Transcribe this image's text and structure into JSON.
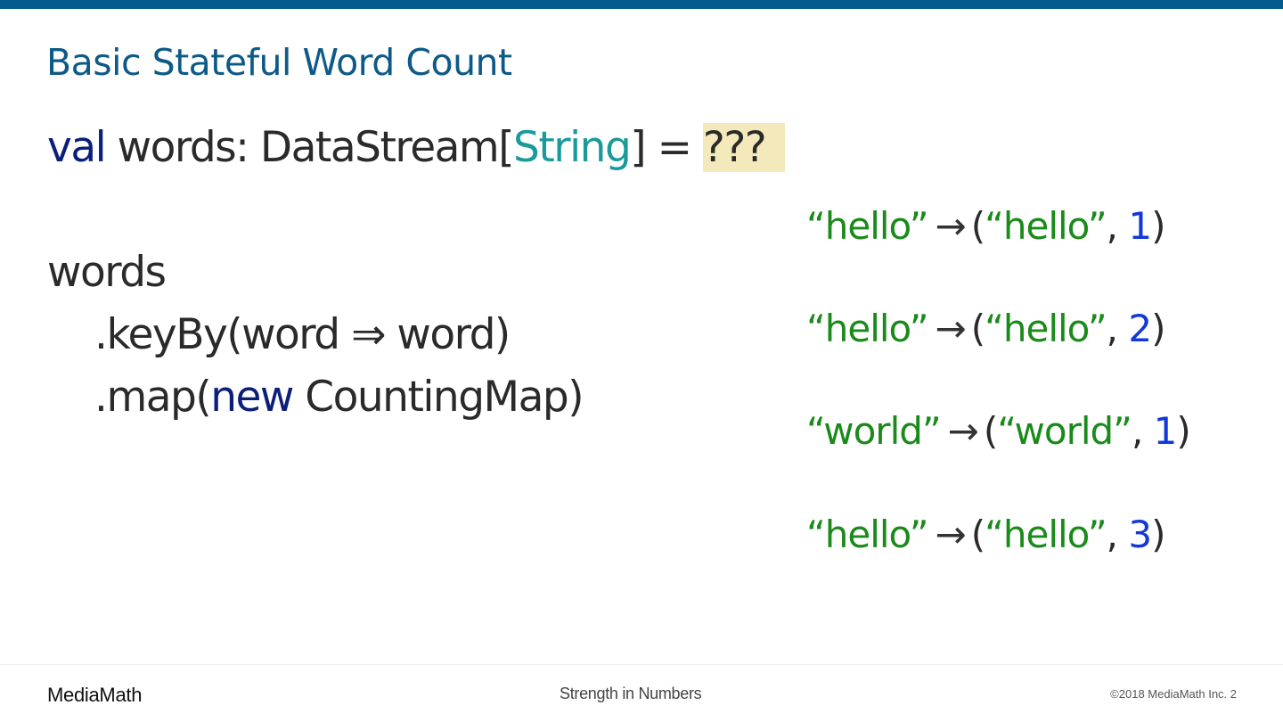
{
  "slide": {
    "title": "Basic Stateful Word Count",
    "code": {
      "line1": {
        "kw": "val",
        "rest1": " words: DataStream[",
        "type": "String",
        "rest2": "] = ",
        "placeholder": "???"
      },
      "line2": "words",
      "line3": ".keyBy(word ⇒ word)",
      "line4": {
        "pre": ".map(",
        "kw": "new",
        "post": " CountingMap)"
      }
    },
    "mappings": [
      {
        "input": "“hello”",
        "arrow": "→",
        "open": "(",
        "key": "“hello”",
        "sep": ", ",
        "count": "1",
        "close": ")"
      },
      {
        "input": "“hello”",
        "arrow": "→",
        "open": "(",
        "key": "“hello”",
        "sep": ", ",
        "count": "2",
        "close": ")"
      },
      {
        "input": "“world”",
        "arrow": "→",
        "open": "(",
        "key": "“world”",
        "sep": ", ",
        "count": "1",
        "close": ")"
      },
      {
        "input": "“hello”",
        "arrow": "→",
        "open": "(",
        "key": "“hello”",
        "sep": ", ",
        "count": "3",
        "close": ")"
      }
    ]
  },
  "footer": {
    "brand": "MediaMath",
    "tagline": "Strength in Numbers",
    "copyright": "©2018 MediaMath Inc.  2"
  },
  "colors": {
    "accent": "#035a8c",
    "keyword": "#0b1f7a",
    "type": "#1a9a9a",
    "string": "#1a8a1a",
    "number": "#1238d8",
    "highlight": "#f3e9bb"
  }
}
